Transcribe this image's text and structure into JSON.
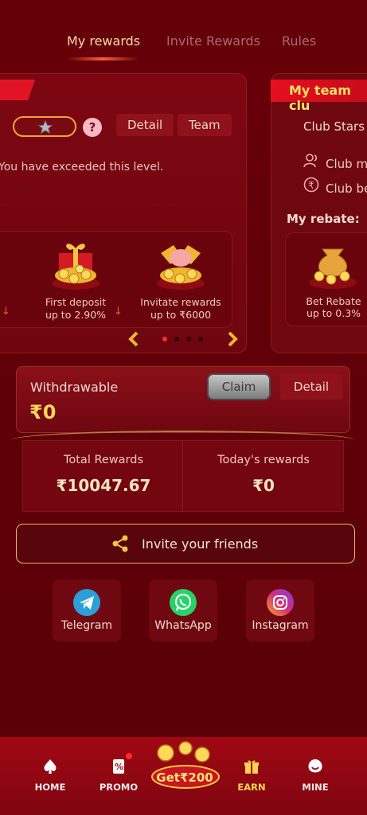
{
  "tabs": [
    {
      "label": "My rewards",
      "active": true
    },
    {
      "label": "Invite Rewards",
      "active": false
    },
    {
      "label": "Rules",
      "active": false
    }
  ],
  "level_card": {
    "detail_label": "Detail",
    "team_label": "Team",
    "exceeded_text": "You have exceeded this level."
  },
  "rewards": [
    {
      "label": "First deposit",
      "value": "up to 2.90%"
    },
    {
      "label": "Invitate rewards",
      "value": "up to ₹6000"
    }
  ],
  "team_card": {
    "title": "My team clu",
    "club_stars": "Club Stars",
    "club_members": "Club me",
    "club_bet": "Club be",
    "my_rebate": "My rebate:",
    "bet_rebate_label": "Bet Rebate",
    "bet_rebate_value": "up to 0.3%"
  },
  "withdraw": {
    "label": "Withdrawable",
    "amount": "₹0",
    "claim": "Claim",
    "detail": "Detail"
  },
  "totals": {
    "total_label": "Total Rewards",
    "total_value": "₹10047.67",
    "today_label": "Today's rewards",
    "today_value": "₹0"
  },
  "invite": {
    "label": "Invite your friends"
  },
  "social": [
    {
      "name": "Telegram",
      "color": "#2a9fd8"
    },
    {
      "name": "WhatsApp",
      "color": "#25d366"
    },
    {
      "name": "Instagram",
      "color": "#d62e7a"
    }
  ],
  "bottom_nav": {
    "home": "HOME",
    "promo": "PROMO",
    "center": "Get₹200",
    "earn": "EARN",
    "mine": "MINE"
  },
  "colors": {
    "accent_gold": "#ffd45a",
    "active_tab": "#f9d9a8",
    "bg": "#5e0008"
  }
}
